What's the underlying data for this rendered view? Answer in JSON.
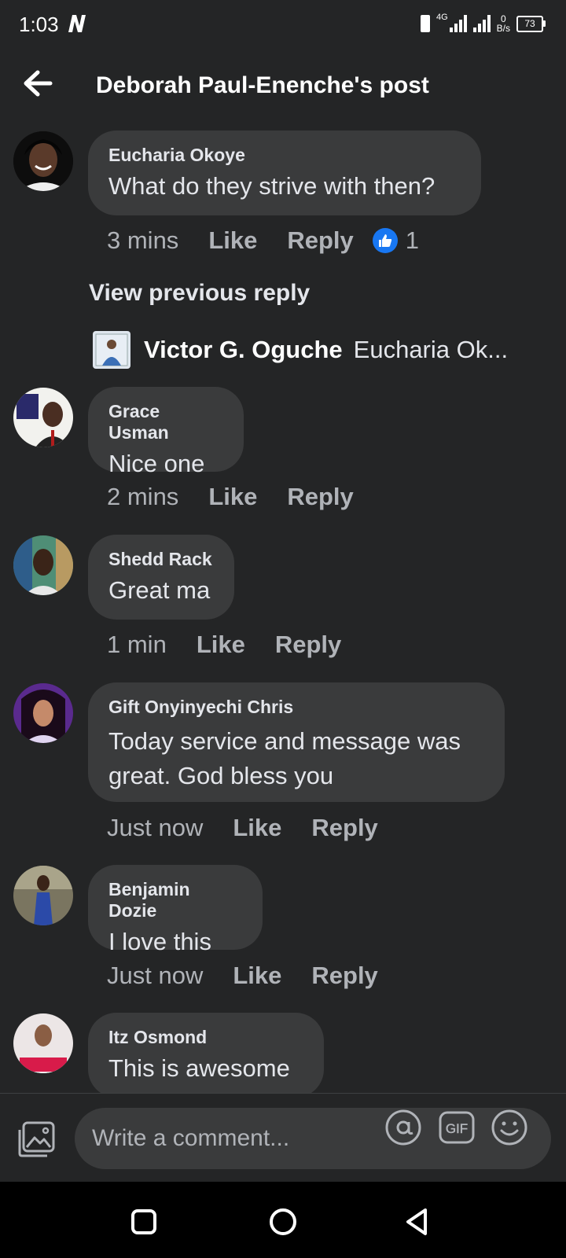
{
  "status_bar": {
    "time": "1:03",
    "network": "4G",
    "speed_value": "0",
    "speed_unit": "B/s",
    "battery": "73"
  },
  "header": {
    "title": "Deborah Paul-Enenche's post"
  },
  "comments": [
    {
      "name": "Eucharia Okoye",
      "text": "What do they strive with then?",
      "time": "3 mins",
      "like": "Like",
      "reply": "Reply",
      "reactions": "1"
    },
    {
      "name": "Grace Usman",
      "text": "Nice one",
      "time": "2 mins",
      "like": "Like",
      "reply": "Reply"
    },
    {
      "name": "Shedd Rack",
      "text": "Great ma",
      "time": "1 min",
      "like": "Like",
      "reply": "Reply"
    },
    {
      "name": "Gift Onyinyechi Chris",
      "text_line1": "Today service and message was",
      "text_line2": "great. God bless you",
      "time": "Just now",
      "like": "Like",
      "reply": "Reply"
    },
    {
      "name": "Benjamin Dozie",
      "text": "I love this",
      "time": "Just now",
      "like": "Like",
      "reply": "Reply"
    },
    {
      "name": "Itz Osmond",
      "text": "This is awesome"
    }
  ],
  "view_previous_reply": "View previous reply",
  "nested_reply": {
    "name": "Victor G. Oguche",
    "text": "Eucharia Ok..."
  },
  "composer": {
    "placeholder": "Write a comment..."
  },
  "colors": {
    "background": "#242526",
    "bubble": "#3a3b3c",
    "accent": "#1877f2",
    "secondary_text": "#b0b3b8"
  }
}
